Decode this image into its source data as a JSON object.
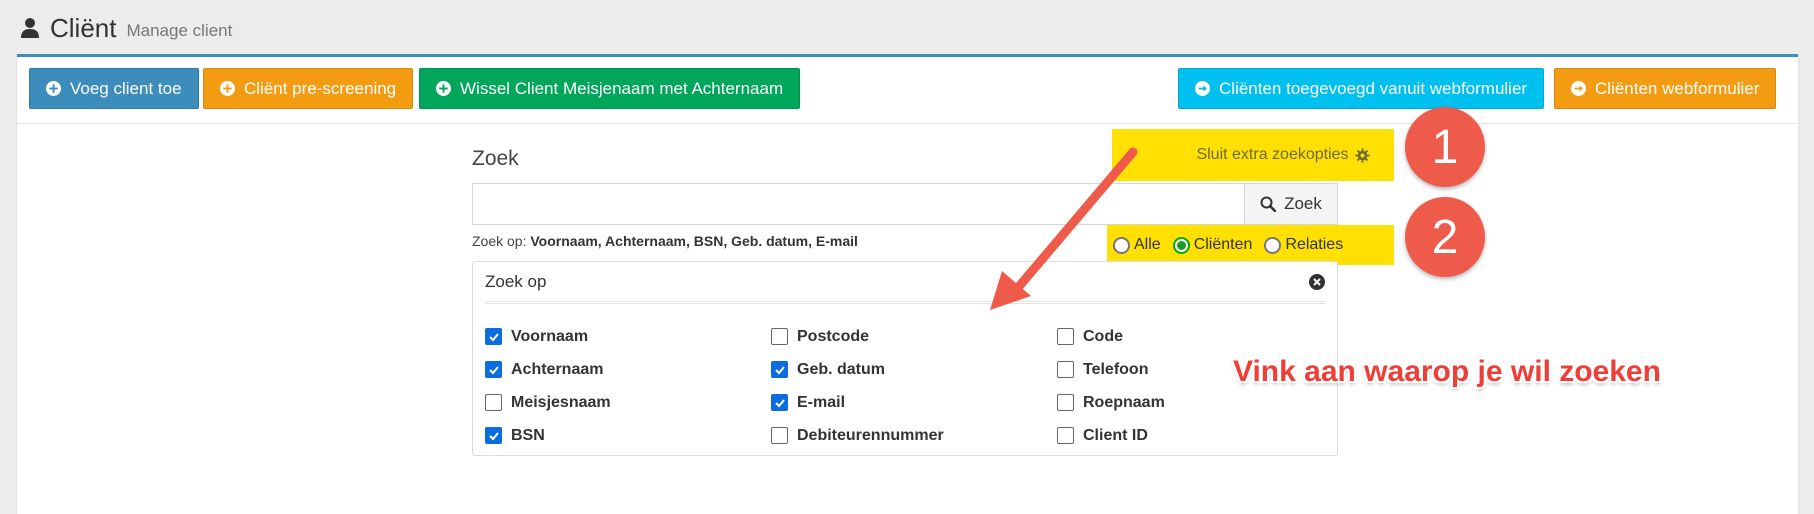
{
  "header": {
    "title": "Cliënt",
    "subtitle": "Manage client",
    "icon": "user-icon"
  },
  "toolbar": {
    "add_client": "Voeg client toe",
    "pre_screening": "Cliënt pre-screening",
    "swap_name": "Wissel Client Meisjenaam met Achternaam",
    "added_from_form": "Cliënten toegevoegd vanuit webformulier",
    "webform": "Cliënten webformulier"
  },
  "search": {
    "label": "Zoek",
    "value": "",
    "placeholder": "",
    "button": "Zoek",
    "hint_prefix": "Zoek op:",
    "hint_fields": "Voornaam, Achternaam, BSN, Geb. datum, E-mail",
    "toggle_extra": "Sluit extra zoekopties",
    "radios": [
      {
        "label": "Alle",
        "checked": false
      },
      {
        "label": "Cliënten",
        "checked": true
      },
      {
        "label": "Relaties",
        "checked": false
      }
    ]
  },
  "zoek_op": {
    "title": "Zoek op",
    "columns": [
      [
        {
          "label": "Voornaam",
          "checked": true
        },
        {
          "label": "Achternaam",
          "checked": true
        },
        {
          "label": "Meisjesnaam",
          "checked": false
        },
        {
          "label": "BSN",
          "checked": true
        }
      ],
      [
        {
          "label": "Postcode",
          "checked": false
        },
        {
          "label": "Geb. datum",
          "checked": true
        },
        {
          "label": "E-mail",
          "checked": true
        },
        {
          "label": "Debiteurennummer",
          "checked": false
        }
      ],
      [
        {
          "label": "Code",
          "checked": false
        },
        {
          "label": "Telefoon",
          "checked": false
        },
        {
          "label": "Roepnaam",
          "checked": false
        },
        {
          "label": "Client ID",
          "checked": false
        }
      ]
    ]
  },
  "annotations": {
    "badge_1": "1",
    "badge_2": "2",
    "note": "Vink aan waarop je wil zoeken"
  },
  "colors": {
    "primary": "#3c8dbc",
    "warning": "#f39c12",
    "success": "#00a65a",
    "info": "#00c0ef",
    "highlight": "#ffe000",
    "annotation_red": "#ef5b4a"
  }
}
